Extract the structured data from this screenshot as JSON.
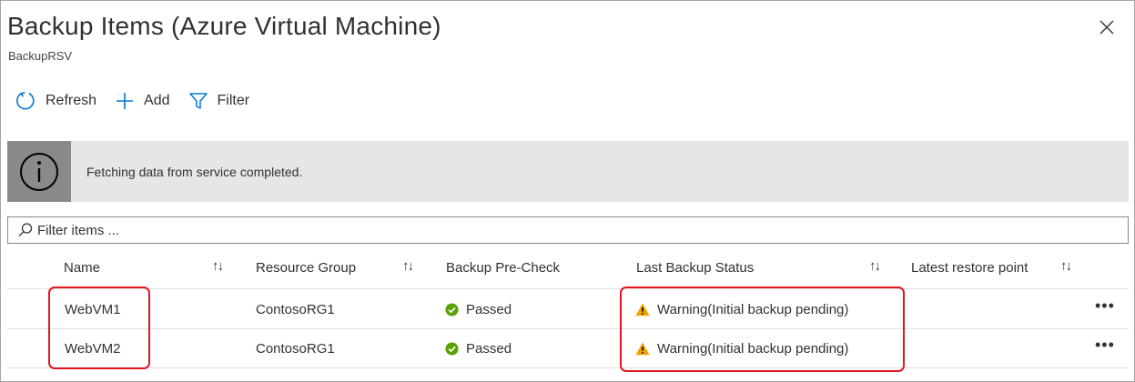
{
  "header": {
    "title": "Backup Items (Azure Virtual Machine)",
    "subtitle": "BackupRSV",
    "close_icon": "close-icon"
  },
  "toolbar": {
    "refresh_label": "Refresh",
    "add_label": "Add",
    "filter_label": "Filter"
  },
  "banner": {
    "icon": "info-icon",
    "message": "Fetching data from service completed."
  },
  "filter": {
    "placeholder": "Filter items ..."
  },
  "table": {
    "columns": [
      {
        "label": "Name",
        "sortable": true
      },
      {
        "label": "Resource Group",
        "sortable": true
      },
      {
        "label": "Backup Pre-Check",
        "sortable": false
      },
      {
        "label": "Last Backup Status",
        "sortable": true
      },
      {
        "label": "Latest restore point",
        "sortable": true
      }
    ],
    "sort_icon": "↑↓",
    "more_label": "•••",
    "rows": [
      {
        "name": "WebVM1",
        "resource_group": "ContosoRG1",
        "precheck": "Passed",
        "last_backup_status": "Warning(Initial backup pending)",
        "latest_restore_point": ""
      },
      {
        "name": "WebVM2",
        "resource_group": "ContosoRG1",
        "precheck": "Passed",
        "last_backup_status": "Warning(Initial backup pending)",
        "latest_restore_point": ""
      }
    ]
  },
  "colors": {
    "success": "#57a300",
    "warning": "#f2a000",
    "highlight": "#e2161f",
    "accent": "#0078d4"
  }
}
